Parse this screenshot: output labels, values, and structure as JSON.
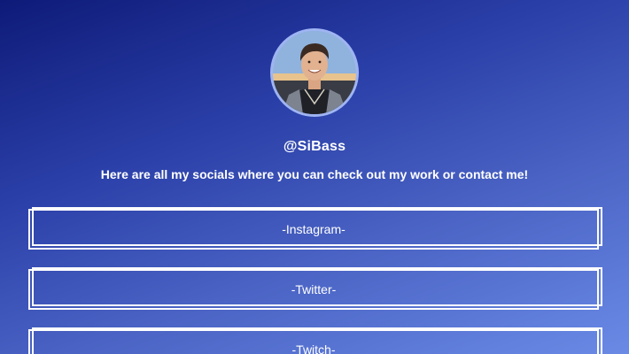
{
  "profile": {
    "handle": "@SiBass",
    "bio": "Here are all my socials where you can check out my work or contact me!"
  },
  "links": [
    {
      "label": "-Instagram-"
    },
    {
      "label": "-Twitter-"
    },
    {
      "label": "-Twitch-"
    }
  ],
  "colors": {
    "gradient_top": "#0e1a78",
    "gradient_bottom": "#6a8ae6",
    "avatar_ring": "#9fb4f2",
    "text": "#ffffff"
  }
}
